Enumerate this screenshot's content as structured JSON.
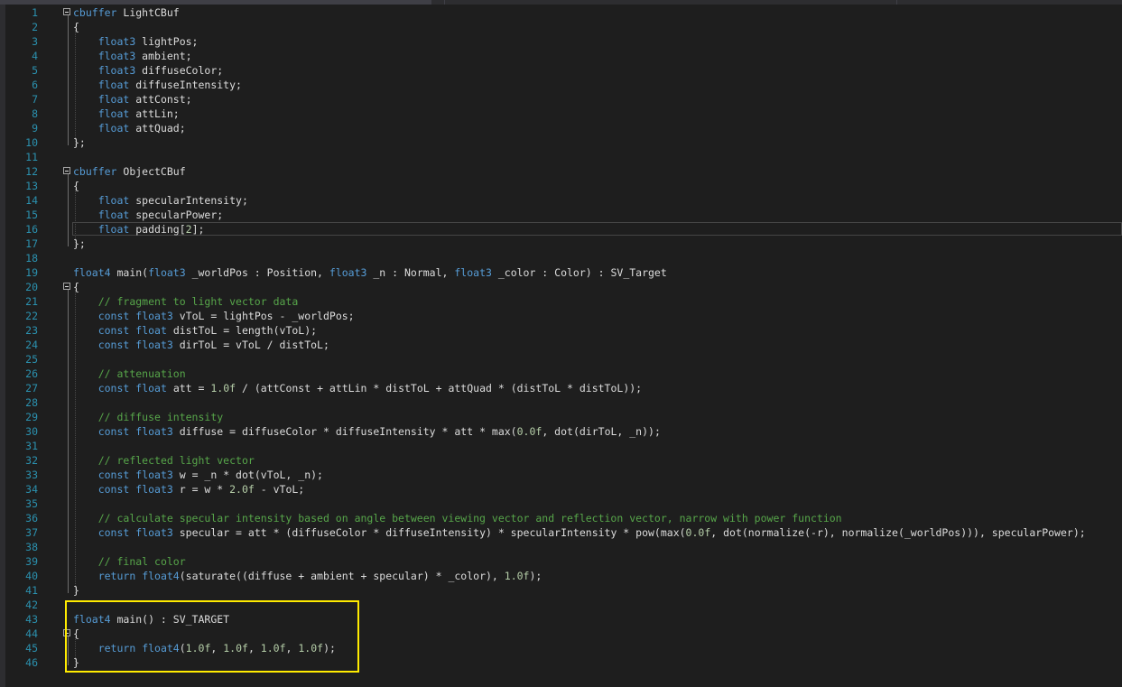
{
  "editor": {
    "language": "HLSL",
    "lines": [
      {
        "n": "1",
        "fold": true,
        "tokens": [
          [
            "kw",
            "cbuffer"
          ],
          [
            "t",
            " LightCBuf"
          ]
        ]
      },
      {
        "n": "2",
        "tokens": [
          [
            "t",
            "{"
          ]
        ]
      },
      {
        "n": "3",
        "tokens": [
          [
            "t",
            "    "
          ],
          [
            "kw",
            "float3"
          ],
          [
            "t",
            " lightPos;"
          ]
        ]
      },
      {
        "n": "4",
        "tokens": [
          [
            "t",
            "    "
          ],
          [
            "kw",
            "float3"
          ],
          [
            "t",
            " ambient;"
          ]
        ]
      },
      {
        "n": "5",
        "tokens": [
          [
            "t",
            "    "
          ],
          [
            "kw",
            "float3"
          ],
          [
            "t",
            " diffuseColor;"
          ]
        ]
      },
      {
        "n": "6",
        "tokens": [
          [
            "t",
            "    "
          ],
          [
            "kw",
            "float"
          ],
          [
            "t",
            " diffuseIntensity;"
          ]
        ]
      },
      {
        "n": "7",
        "tokens": [
          [
            "t",
            "    "
          ],
          [
            "kw",
            "float"
          ],
          [
            "t",
            " attConst;"
          ]
        ]
      },
      {
        "n": "8",
        "tokens": [
          [
            "t",
            "    "
          ],
          [
            "kw",
            "float"
          ],
          [
            "t",
            " attLin;"
          ]
        ]
      },
      {
        "n": "9",
        "tokens": [
          [
            "t",
            "    "
          ],
          [
            "kw",
            "float"
          ],
          [
            "t",
            " attQuad;"
          ]
        ]
      },
      {
        "n": "10",
        "tokens": [
          [
            "t",
            "};"
          ]
        ]
      },
      {
        "n": "11",
        "tokens": []
      },
      {
        "n": "12",
        "fold": true,
        "tokens": [
          [
            "kw",
            "cbuffer"
          ],
          [
            "t",
            " ObjectCBuf"
          ]
        ]
      },
      {
        "n": "13",
        "tokens": [
          [
            "t",
            "{"
          ]
        ]
      },
      {
        "n": "14",
        "tokens": [
          [
            "t",
            "    "
          ],
          [
            "kw",
            "float"
          ],
          [
            "t",
            " specularIntensity;"
          ]
        ]
      },
      {
        "n": "15",
        "tokens": [
          [
            "t",
            "    "
          ],
          [
            "kw",
            "float"
          ],
          [
            "t",
            " specularPower;"
          ]
        ]
      },
      {
        "n": "16",
        "tokens": [
          [
            "t",
            "    "
          ],
          [
            "kw",
            "float"
          ],
          [
            "t",
            " padding["
          ],
          [
            "num",
            "2"
          ],
          [
            "t",
            "];"
          ]
        ]
      },
      {
        "n": "17",
        "tokens": [
          [
            "t",
            "};"
          ]
        ]
      },
      {
        "n": "18",
        "tokens": []
      },
      {
        "n": "19",
        "tokens": [
          [
            "kw",
            "float4"
          ],
          [
            "t",
            " main("
          ],
          [
            "kw",
            "float3"
          ],
          [
            "t",
            " _worldPos : Position, "
          ],
          [
            "kw",
            "float3"
          ],
          [
            "t",
            " _n : Normal, "
          ],
          [
            "kw",
            "float3"
          ],
          [
            "t",
            " _color : Color) : SV_Target"
          ]
        ]
      },
      {
        "n": "20",
        "fold": true,
        "tokens": [
          [
            "t",
            "{"
          ]
        ]
      },
      {
        "n": "21",
        "tokens": [
          [
            "t",
            "    "
          ],
          [
            "cm",
            "// fragment to light vector data"
          ]
        ]
      },
      {
        "n": "22",
        "tokens": [
          [
            "t",
            "    "
          ],
          [
            "kw",
            "const"
          ],
          [
            "t",
            " "
          ],
          [
            "kw",
            "float3"
          ],
          [
            "t",
            " vToL = lightPos - _worldPos;"
          ]
        ]
      },
      {
        "n": "23",
        "tokens": [
          [
            "t",
            "    "
          ],
          [
            "kw",
            "const"
          ],
          [
            "t",
            " "
          ],
          [
            "kw",
            "float"
          ],
          [
            "t",
            " distToL = length(vToL);"
          ]
        ]
      },
      {
        "n": "24",
        "tokens": [
          [
            "t",
            "    "
          ],
          [
            "kw",
            "const"
          ],
          [
            "t",
            " "
          ],
          [
            "kw",
            "float3"
          ],
          [
            "t",
            " dirToL = vToL / distToL;"
          ]
        ]
      },
      {
        "n": "25",
        "tokens": []
      },
      {
        "n": "26",
        "tokens": [
          [
            "t",
            "    "
          ],
          [
            "cm",
            "// attenuation"
          ]
        ]
      },
      {
        "n": "27",
        "tokens": [
          [
            "t",
            "    "
          ],
          [
            "kw",
            "const"
          ],
          [
            "t",
            " "
          ],
          [
            "kw",
            "float"
          ],
          [
            "t",
            " att = "
          ],
          [
            "num",
            "1.0f"
          ],
          [
            "t",
            " / (attConst + attLin * distToL + attQuad * (distToL * distToL));"
          ]
        ]
      },
      {
        "n": "28",
        "tokens": []
      },
      {
        "n": "29",
        "tokens": [
          [
            "t",
            "    "
          ],
          [
            "cm",
            "// diffuse intensity"
          ]
        ]
      },
      {
        "n": "30",
        "tokens": [
          [
            "t",
            "    "
          ],
          [
            "kw",
            "const"
          ],
          [
            "t",
            " "
          ],
          [
            "kw",
            "float3"
          ],
          [
            "t",
            " diffuse = diffuseColor * diffuseIntensity * att * max("
          ],
          [
            "num",
            "0.0f"
          ],
          [
            "t",
            ", dot(dirToL, _n));"
          ]
        ]
      },
      {
        "n": "31",
        "tokens": []
      },
      {
        "n": "32",
        "tokens": [
          [
            "t",
            "    "
          ],
          [
            "cm",
            "// reflected light vector"
          ]
        ]
      },
      {
        "n": "33",
        "tokens": [
          [
            "t",
            "    "
          ],
          [
            "kw",
            "const"
          ],
          [
            "t",
            " "
          ],
          [
            "kw",
            "float3"
          ],
          [
            "t",
            " w = _n * dot(vToL, _n);"
          ]
        ]
      },
      {
        "n": "34",
        "tokens": [
          [
            "t",
            "    "
          ],
          [
            "kw",
            "const"
          ],
          [
            "t",
            " "
          ],
          [
            "kw",
            "float3"
          ],
          [
            "t",
            " r = w * "
          ],
          [
            "num",
            "2.0f"
          ],
          [
            "t",
            " - vToL;"
          ]
        ]
      },
      {
        "n": "35",
        "tokens": []
      },
      {
        "n": "36",
        "tokens": [
          [
            "t",
            "    "
          ],
          [
            "cm",
            "// calculate specular intensity based on angle between viewing vector and reflection vector, narrow with power function"
          ]
        ]
      },
      {
        "n": "37",
        "tokens": [
          [
            "t",
            "    "
          ],
          [
            "kw",
            "const"
          ],
          [
            "t",
            " "
          ],
          [
            "kw",
            "float3"
          ],
          [
            "t",
            " specular = att * (diffuseColor * diffuseIntensity) * specularIntensity * pow(max("
          ],
          [
            "num",
            "0.0f"
          ],
          [
            "t",
            ", dot(normalize(-r), normalize(_worldPos))), specularPower);"
          ]
        ]
      },
      {
        "n": "38",
        "tokens": []
      },
      {
        "n": "39",
        "tokens": [
          [
            "t",
            "    "
          ],
          [
            "cm",
            "// final color"
          ]
        ]
      },
      {
        "n": "40",
        "tokens": [
          [
            "t",
            "    "
          ],
          [
            "kw",
            "return"
          ],
          [
            "t",
            " "
          ],
          [
            "kw",
            "float4"
          ],
          [
            "t",
            "(saturate((diffuse + ambient + specular) * _color), "
          ],
          [
            "num",
            "1.0f"
          ],
          [
            "t",
            ");"
          ]
        ]
      },
      {
        "n": "41",
        "tokens": [
          [
            "t",
            "}"
          ]
        ]
      },
      {
        "n": "42",
        "tokens": []
      },
      {
        "n": "43",
        "tokens": [
          [
            "kw",
            "float4"
          ],
          [
            "t",
            " main() : SV_TARGET"
          ]
        ]
      },
      {
        "n": "44",
        "fold": true,
        "tokens": [
          [
            "t",
            "{"
          ]
        ]
      },
      {
        "n": "45",
        "tokens": [
          [
            "t",
            "    "
          ],
          [
            "kw",
            "return"
          ],
          [
            "t",
            " "
          ],
          [
            "kw",
            "float4"
          ],
          [
            "t",
            "("
          ],
          [
            "num",
            "1.0f"
          ],
          [
            "t",
            ", "
          ],
          [
            "num",
            "1.0f"
          ],
          [
            "t",
            ", "
          ],
          [
            "num",
            "1.0f"
          ],
          [
            "t",
            ", "
          ],
          [
            "num",
            "1.0f"
          ],
          [
            "t",
            ");"
          ]
        ]
      },
      {
        "n": "46",
        "tokens": [
          [
            "t",
            "}"
          ]
        ]
      }
    ]
  },
  "colors": {
    "background": "#1e1e1e",
    "keyword": "#569cd6",
    "comment": "#57a64a",
    "number": "#b5cea8",
    "line_number": "#2b91af",
    "highlight_box": "#ffeb00"
  }
}
